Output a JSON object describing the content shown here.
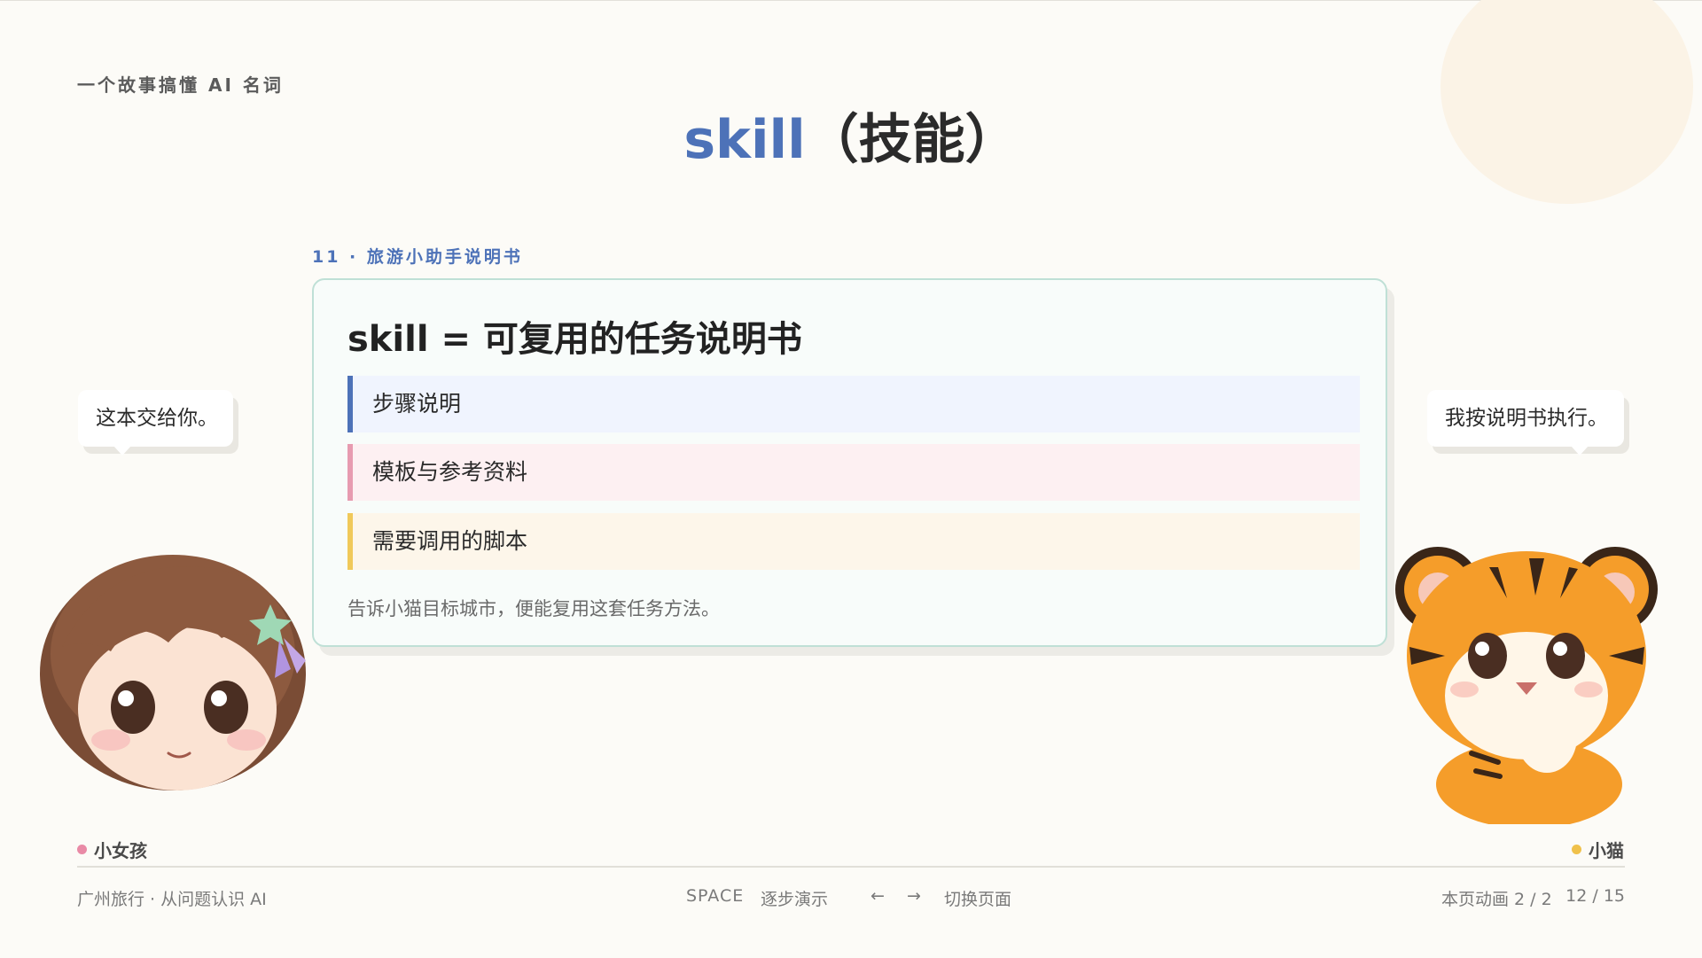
{
  "header": {
    "series": "一个故事搞懂 AI 名词",
    "title_term": "skill",
    "title_rest": "（技能）"
  },
  "section": {
    "label": "11 · 旅游小助手说明书"
  },
  "card": {
    "heading": "skill = 可复用的任务说明书",
    "rows": [
      {
        "label": "步骤说明",
        "color": "#4d72b8"
      },
      {
        "label": "模板与参考资料",
        "color": "#e79bb0"
      },
      {
        "label": "需要调用的脚本",
        "color": "#f0c95a"
      }
    ],
    "note": "告诉小猫目标城市，便能复用这套任务方法。"
  },
  "dialog": {
    "girl_line": "这本交给你。",
    "tiger_line": "我按说明书执行。"
  },
  "characters": {
    "girl": {
      "name": "小女孩",
      "dot_color": "#e98aa6",
      "icon": "girl-avatar"
    },
    "tiger": {
      "name": "小猫",
      "dot_color": "#f0c14b",
      "icon": "tiger-cub-avatar"
    }
  },
  "footer": {
    "course": "广州旅行 · 从问题认识 AI",
    "space_key": "SPACE",
    "space_desc": "逐步演示",
    "arrow_left": "←",
    "arrow_right": "→",
    "nav_desc": "切换页面",
    "animation_status": "本页动画 2 / 2",
    "page_counter": "12 / 15"
  },
  "colors": {
    "accent": "#4d72b8",
    "background": "#fcfbf7",
    "card_border": "#bfe0d6"
  }
}
